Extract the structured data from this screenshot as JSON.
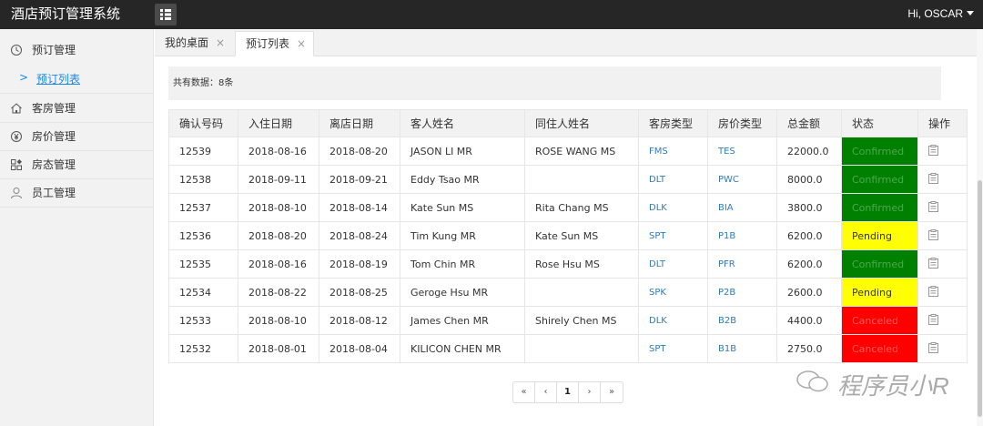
{
  "app": {
    "title": "酒店预订管理系统",
    "user_label": "Hi, OSCAR"
  },
  "sidebar": {
    "items": [
      {
        "label": "预订管理",
        "icon": "history-icon"
      },
      {
        "label": "客房管理",
        "icon": "home-icon"
      },
      {
        "label": "房价管理",
        "icon": "yen-icon"
      },
      {
        "label": "房态管理",
        "icon": "dashboard-icon"
      },
      {
        "label": "员工管理",
        "icon": "user-icon"
      }
    ],
    "sub_item": {
      "label": "预订列表"
    }
  },
  "tabs": [
    {
      "label": "我的桌面",
      "close": "×"
    },
    {
      "label": "预订列表",
      "close": "×"
    }
  ],
  "summary": "共有数据：8条",
  "table": {
    "headers": [
      "确认号码",
      "入住日期",
      "离店日期",
      "客人姓名",
      "同住人姓名",
      "客房类型",
      "房价类型",
      "总金额",
      "状态",
      "操作"
    ],
    "rows": [
      {
        "id": "12539",
        "checkin": "2018-08-16",
        "checkout": "2018-08-20",
        "guest": "JASON LI MR",
        "roommate": "ROSE WANG MS",
        "room": "FMS",
        "rate": "TES",
        "total": "22000.0",
        "status": "Confirmed",
        "status_key": "confirmed"
      },
      {
        "id": "12538",
        "checkin": "2018-09-11",
        "checkout": "2018-09-21",
        "guest": "Eddy Tsao MR",
        "roommate": "",
        "room": "DLT",
        "rate": "PWC",
        "total": "8000.0",
        "status": "Confirmed",
        "status_key": "confirmed"
      },
      {
        "id": "12537",
        "checkin": "2018-08-10",
        "checkout": "2018-08-14",
        "guest": "Kate Sun MS",
        "roommate": "Rita Chang MS",
        "room": "DLK",
        "rate": "BIA",
        "total": "3800.0",
        "status": "Confirmed",
        "status_key": "confirmed"
      },
      {
        "id": "12536",
        "checkin": "2018-08-20",
        "checkout": "2018-08-24",
        "guest": "Tim Kung MR",
        "roommate": "Kate Sun MS",
        "room": "SPT",
        "rate": "P1B",
        "total": "6200.0",
        "status": "Pending",
        "status_key": "pending"
      },
      {
        "id": "12535",
        "checkin": "2018-08-16",
        "checkout": "2018-08-19",
        "guest": "Tom Chin MR",
        "roommate": "Rose Hsu MS",
        "room": "DLT",
        "rate": "PFR",
        "total": "6200.0",
        "status": "Confirmed",
        "status_key": "confirmed"
      },
      {
        "id": "12534",
        "checkin": "2018-08-22",
        "checkout": "2018-08-25",
        "guest": "Geroge Hsu MR",
        "roommate": "",
        "room": "SPK",
        "rate": "P2B",
        "total": "2600.0",
        "status": "Pending",
        "status_key": "pending"
      },
      {
        "id": "12533",
        "checkin": "2018-08-10",
        "checkout": "2018-08-12",
        "guest": "James Chen MR",
        "roommate": "Shirely Chen MS",
        "room": "DLK",
        "rate": "B2B",
        "total": "4400.0",
        "status": "Canceled",
        "status_key": "canceled"
      },
      {
        "id": "12532",
        "checkin": "2018-08-01",
        "checkout": "2018-08-04",
        "guest": "KILICON CHEN MR",
        "roommate": "",
        "room": "SPT",
        "rate": "B1B",
        "total": "2750.0",
        "status": "Canceled",
        "status_key": "canceled"
      }
    ]
  },
  "pagination": {
    "first": "«",
    "prev": "‹",
    "current": "1",
    "next": "›",
    "last": "»"
  },
  "watermark": "程序员小R",
  "colors": {
    "confirmed": "#008000",
    "pending": "#ffff00",
    "canceled": "#ff0000",
    "link": "#337ab7",
    "topbar": "#262626"
  }
}
